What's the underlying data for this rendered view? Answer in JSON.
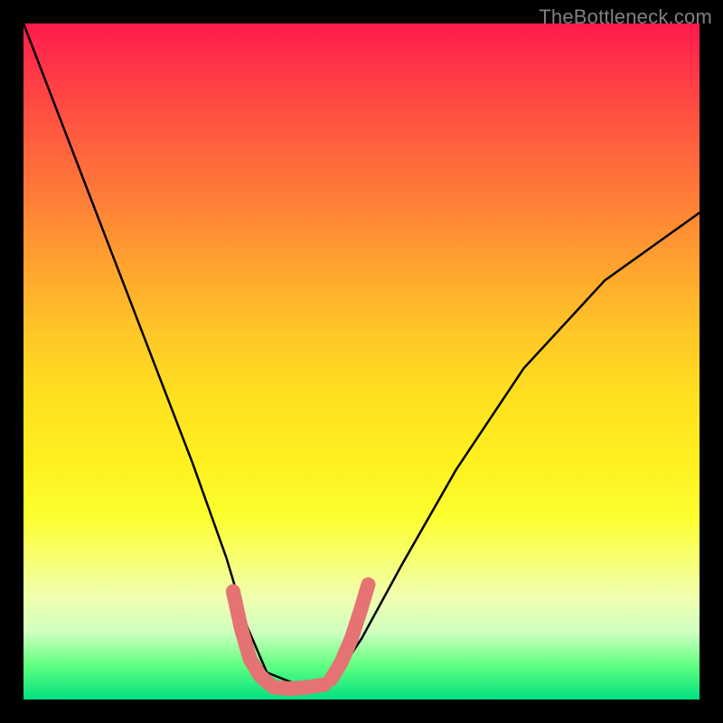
{
  "watermark": "TheBottleneck.com",
  "chart_data": {
    "type": "line",
    "title": "",
    "xlabel": "",
    "ylabel": "",
    "xlim": [
      0,
      1
    ],
    "ylim": [
      0,
      1
    ],
    "series": [
      {
        "name": "bottleneck-curve",
        "x": [
          0.0,
          0.05,
          0.1,
          0.15,
          0.2,
          0.25,
          0.3,
          0.33,
          0.36,
          0.41,
          0.46,
          0.5,
          0.56,
          0.64,
          0.74,
          0.86,
          1.0
        ],
        "y": [
          1.0,
          0.87,
          0.74,
          0.61,
          0.48,
          0.35,
          0.21,
          0.11,
          0.04,
          0.02,
          0.03,
          0.09,
          0.2,
          0.34,
          0.49,
          0.62,
          0.72
        ]
      }
    ],
    "marker_segments": [
      {
        "name": "left-marker",
        "x": [
          0.31,
          0.322,
          0.335,
          0.35,
          0.365
        ],
        "y": [
          0.16,
          0.105,
          0.06,
          0.035,
          0.022
        ]
      },
      {
        "name": "bottom-marker",
        "x": [
          0.37,
          0.395,
          0.42,
          0.445
        ],
        "y": [
          0.018,
          0.016,
          0.018,
          0.022
        ]
      },
      {
        "name": "right-marker",
        "x": [
          0.455,
          0.47,
          0.485,
          0.498,
          0.51
        ],
        "y": [
          0.03,
          0.055,
          0.09,
          0.13,
          0.17
        ]
      }
    ],
    "marker_color": "#e57373"
  }
}
